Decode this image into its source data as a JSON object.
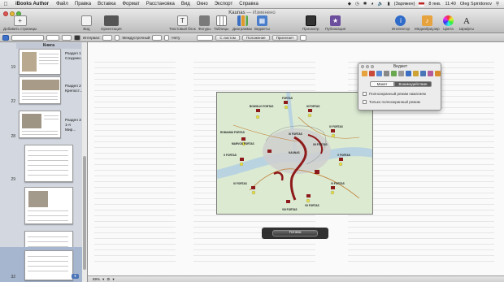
{
  "menubar": {
    "app_name": "iBooks Author",
    "items": [
      "Файл",
      "Правка",
      "Вставка",
      "Формат",
      "Расстановка",
      "Вид",
      "Окно",
      "Экспорт",
      "Справка"
    ],
    "status_charging": "(Заряжен)",
    "date": "8 янв.",
    "time": "11:40",
    "user": "Oleg Spiridonov"
  },
  "window": {
    "title": "Kaunas",
    "edited_label": "— Изменено"
  },
  "toolbar": {
    "add_page": "Добавить страницы",
    "view": "Вид",
    "orientation": "Ориентация",
    "textbox": "Текстовый блок",
    "shapes": "Фигуры",
    "tables": "Таблицы",
    "charts": "Диаграммы",
    "widgets": "Виджеты",
    "preview": "Просмотр",
    "publish": "Публикация",
    "inspector": "Инспектор",
    "media": "Медиабраузер",
    "colors": "Цвета",
    "fonts": "Шрифты"
  },
  "formatbar": {
    "spacing_label": "Интервал:",
    "indent_label": "Междустрочный",
    "list_label": "Нету",
    "btn_page": "С листом",
    "btn_layout": "Положение",
    "btn_wrap": "Прилегает"
  },
  "sidebar": {
    "book_label": "Книга",
    "thumbs": [
      {
        "num": "19",
        "section": "Раздел 1",
        "subtitle": "Создани..."
      },
      {
        "num": "22",
        "section": "Раздел 2",
        "subtitle": "Крепост..."
      },
      {
        "num": "28",
        "section": "Раздел 3",
        "subtitle": "1-я Мир..."
      },
      {
        "num": "29",
        "section": "",
        "subtitle": ""
      },
      {
        "num": "30",
        "section": "",
        "subtitle": ""
      },
      {
        "num": "31",
        "section": "",
        "subtitle": ""
      },
      {
        "num": "32",
        "section": "",
        "subtitle": ""
      }
    ]
  },
  "map_labels": [
    "BOWGLIO FORTAS",
    "FORTAS",
    "III FORTAS",
    "IV FORTAS",
    "V FORTAS",
    "VI FORTAS",
    "VII FORTAS",
    "VIII FORTAS",
    "IX FORTAS",
    "X FORTAS",
    "XI FORTAS",
    "XII FORTAS",
    "ROMAINIU FORTAS",
    "MARVOS FORTAS",
    "KAUNAS"
  ],
  "widget_panel": {
    "title": "Виджет",
    "tab_layout": "Макет",
    "tab_interaction": "Взаимодействие",
    "opt_tap": "Полноэкранный режим нажатием",
    "opt_only": "Только полноэкранный режим"
  },
  "done_label": "Готово",
  "zoom": "89%",
  "colors": {
    "accent_blue": "#3d70c9",
    "map_green": "#d9e8cf",
    "fort_red": "#8e1b1b"
  }
}
